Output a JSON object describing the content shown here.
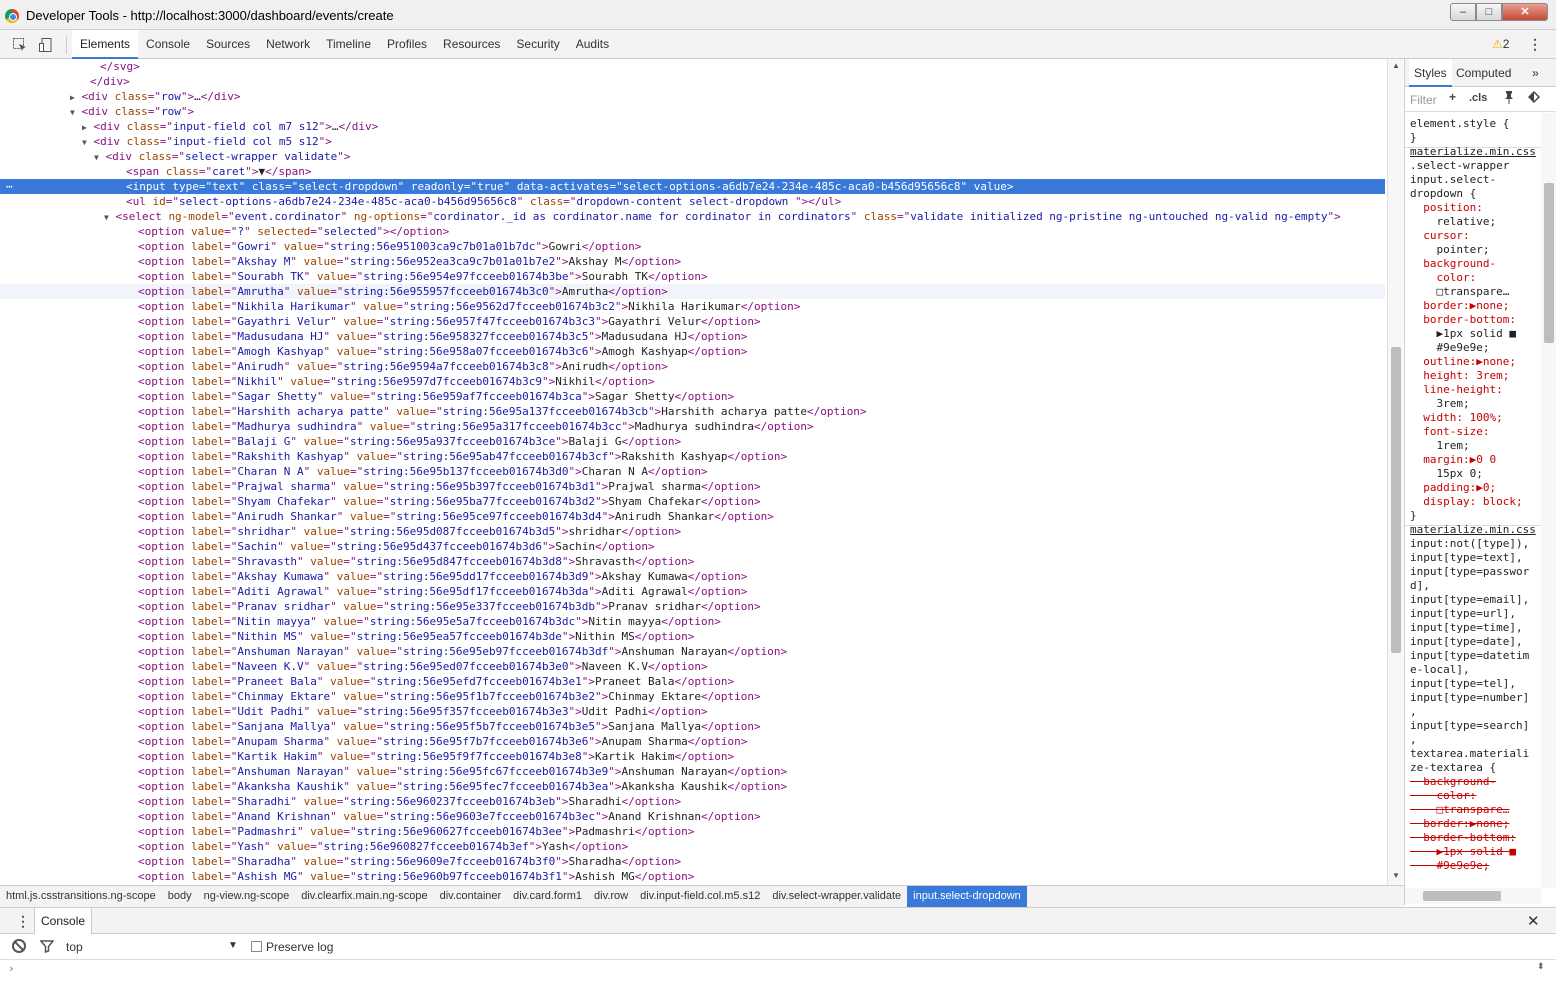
{
  "window": {
    "title": "Developer Tools - http://localhost:3000/dashboard/events/create",
    "min_label": "–",
    "max_label": "□",
    "close_label": "✕"
  },
  "toolbar": {
    "tabs": [
      "Elements",
      "Console",
      "Sources",
      "Network",
      "Timeline",
      "Profiles",
      "Resources",
      "Security",
      "Audits"
    ],
    "active_tab": "Elements",
    "warning_count": "2",
    "icons": [
      "inspect-icon",
      "device-mode-icon",
      "warning-icon",
      "kebab-menu-icon"
    ]
  },
  "tree": {
    "selected_index": 8,
    "hover_index": 15,
    "lines": [
      {
        "indent": 100,
        "parts": [
          [
            "t",
            "</svg>"
          ]
        ]
      },
      {
        "indent": 90,
        "parts": [
          [
            "t",
            "</div>"
          ]
        ]
      },
      {
        "indent": 80,
        "tri": "r",
        "parts": [
          [
            "t",
            "<div "
          ],
          [
            "a",
            "class"
          ],
          [
            "t",
            "=\""
          ],
          [
            "v",
            "row"
          ],
          [
            "t",
            "\">"
          ],
          [
            "x",
            "…"
          ],
          [
            "t",
            "</div>"
          ]
        ]
      },
      {
        "indent": 80,
        "tri": "d",
        "parts": [
          [
            "t",
            "<div "
          ],
          [
            "a",
            "class"
          ],
          [
            "t",
            "=\""
          ],
          [
            "v",
            "row"
          ],
          [
            "t",
            "\">"
          ]
        ]
      },
      {
        "indent": 92,
        "tri": "r",
        "parts": [
          [
            "t",
            "<div "
          ],
          [
            "a",
            "class"
          ],
          [
            "t",
            "=\""
          ],
          [
            "v",
            "input-field col m7 s12"
          ],
          [
            "t",
            "\">"
          ],
          [
            "x",
            "…"
          ],
          [
            "t",
            "</div>"
          ]
        ]
      },
      {
        "indent": 92,
        "tri": "d",
        "parts": [
          [
            "t",
            "<div "
          ],
          [
            "a",
            "class"
          ],
          [
            "t",
            "=\""
          ],
          [
            "v",
            "input-field col m5 s12"
          ],
          [
            "t",
            "\">"
          ]
        ]
      },
      {
        "indent": 104,
        "tri": "d",
        "parts": [
          [
            "t",
            "<div "
          ],
          [
            "a",
            "class"
          ],
          [
            "t",
            "=\""
          ],
          [
            "v",
            "select-wrapper validate"
          ],
          [
            "t",
            "\">"
          ]
        ]
      },
      {
        "indent": 126,
        "parts": [
          [
            "t",
            "<span "
          ],
          [
            "a",
            "class"
          ],
          [
            "t",
            "=\""
          ],
          [
            "v",
            "caret"
          ],
          [
            "t",
            "\">"
          ],
          [
            "x",
            "▼"
          ],
          [
            "t",
            "</span>"
          ]
        ]
      },
      {
        "indent": 126,
        "dots": true,
        "parts": [
          [
            "t",
            "<input "
          ],
          [
            "a",
            "type"
          ],
          [
            "t",
            "=\""
          ],
          [
            "v",
            "text"
          ],
          [
            "t",
            "\" "
          ],
          [
            "a",
            "class"
          ],
          [
            "t",
            "=\""
          ],
          [
            "v",
            "select-dropdown"
          ],
          [
            "t",
            "\" "
          ],
          [
            "a",
            "readonly"
          ],
          [
            "t",
            "=\""
          ],
          [
            "v",
            "true"
          ],
          [
            "t",
            "\" "
          ],
          [
            "a",
            "data-activates"
          ],
          [
            "t",
            "=\""
          ],
          [
            "v",
            "select-options-a6db7e24-234e-485c-aca0-b456d95656c8"
          ],
          [
            "t",
            "\" "
          ],
          [
            "a",
            "value"
          ],
          [
            "t",
            ">"
          ]
        ]
      },
      {
        "indent": 126,
        "parts": [
          [
            "t",
            "<ul "
          ],
          [
            "a",
            "id"
          ],
          [
            "t",
            "=\""
          ],
          [
            "v",
            "select-options-a6db7e24-234e-485c-aca0-b456d95656c8"
          ],
          [
            "t",
            "\" "
          ],
          [
            "a",
            "class"
          ],
          [
            "t",
            "=\""
          ],
          [
            "v",
            "dropdown-content select-dropdown "
          ],
          [
            "t",
            "\"></ul>"
          ]
        ]
      },
      {
        "indent": 114,
        "tri": "d",
        "parts": [
          [
            "t",
            "<select "
          ],
          [
            "a",
            "ng-model"
          ],
          [
            "t",
            "=\""
          ],
          [
            "v",
            "event.cordinator"
          ],
          [
            "t",
            "\" "
          ],
          [
            "a",
            "ng-options"
          ],
          [
            "t",
            "=\""
          ],
          [
            "v",
            "cordinator._id as cordinator.name for cordinator in cordinators"
          ],
          [
            "t",
            "\" "
          ],
          [
            "a",
            "class"
          ],
          [
            "t",
            "=\""
          ],
          [
            "v",
            "validate initialized ng-pristine ng-untouched ng-valid ng-empty"
          ],
          [
            "t",
            "\">"
          ]
        ]
      },
      {
        "indent": 138,
        "parts": [
          [
            "t",
            "<option "
          ],
          [
            "a",
            "value"
          ],
          [
            "t",
            "=\""
          ],
          [
            "v",
            "?"
          ],
          [
            "t",
            "\" "
          ],
          [
            "a",
            "selected"
          ],
          [
            "t",
            "=\""
          ],
          [
            "v",
            "selected"
          ],
          [
            "t",
            "\"></option>"
          ]
        ]
      },
      {
        "indent": 138,
        "opt": [
          "Gowri",
          "string:56e951003ca9c7b01a01b7dc"
        ]
      },
      {
        "indent": 138,
        "opt": [
          "Akshay M",
          "string:56e952ea3ca9c7b01a01b7e2"
        ]
      },
      {
        "indent": 138,
        "opt": [
          "Sourabh TK",
          "string:56e954e97fcceeb01674b3be"
        ]
      },
      {
        "indent": 138,
        "opt": [
          "Amrutha",
          "string:56e955957fcceeb01674b3c0"
        ]
      },
      {
        "indent": 138,
        "opt": [
          "Nikhila Harikumar",
          "string:56e9562d7fcceeb01674b3c2"
        ]
      },
      {
        "indent": 138,
        "opt": [
          "Gayathri Velur",
          "string:56e957f47fcceeb01674b3c3"
        ]
      },
      {
        "indent": 138,
        "opt": [
          "Madusudana HJ",
          "string:56e958327fcceeb01674b3c5"
        ]
      },
      {
        "indent": 138,
        "opt": [
          "Amogh Kashyap",
          "string:56e958a07fcceeb01674b3c6"
        ]
      },
      {
        "indent": 138,
        "opt": [
          "Anirudh",
          "string:56e9594a7fcceeb01674b3c8"
        ]
      },
      {
        "indent": 138,
        "opt": [
          "Nikhil",
          "string:56e9597d7fcceeb01674b3c9"
        ]
      },
      {
        "indent": 138,
        "opt": [
          "Sagar Shetty",
          "string:56e959af7fcceeb01674b3ca"
        ]
      },
      {
        "indent": 138,
        "opt": [
          "Harshith acharya patte",
          "string:56e95a137fcceeb01674b3cb"
        ]
      },
      {
        "indent": 138,
        "opt": [
          "Madhurya sudhindra",
          "string:56e95a317fcceeb01674b3cc"
        ]
      },
      {
        "indent": 138,
        "opt": [
          "Balaji G",
          "string:56e95a937fcceeb01674b3ce"
        ]
      },
      {
        "indent": 138,
        "opt": [
          "Rakshith Kashyap",
          "string:56e95ab47fcceeb01674b3cf"
        ]
      },
      {
        "indent": 138,
        "opt": [
          "Charan N A",
          "string:56e95b137fcceeb01674b3d0"
        ]
      },
      {
        "indent": 138,
        "opt": [
          "Prajwal sharma",
          "string:56e95b397fcceeb01674b3d1"
        ]
      },
      {
        "indent": 138,
        "opt": [
          "Shyam Chafekar",
          "string:56e95ba77fcceeb01674b3d2"
        ]
      },
      {
        "indent": 138,
        "opt": [
          "Anirudh Shankar",
          "string:56e95ce97fcceeb01674b3d4"
        ]
      },
      {
        "indent": 138,
        "opt": [
          "shridhar",
          "string:56e95d087fcceeb01674b3d5"
        ]
      },
      {
        "indent": 138,
        "opt": [
          "Sachin",
          "string:56e95d437fcceeb01674b3d6"
        ]
      },
      {
        "indent": 138,
        "opt": [
          "Shravasth",
          "string:56e95d847fcceeb01674b3d8"
        ]
      },
      {
        "indent": 138,
        "opt": [
          "Akshay Kumawa",
          "string:56e95dd17fcceeb01674b3d9"
        ]
      },
      {
        "indent": 138,
        "opt": [
          "Aditi Agrawal",
          "string:56e95df17fcceeb01674b3da"
        ]
      },
      {
        "indent": 138,
        "opt": [
          "Pranav sridhar",
          "string:56e95e337fcceeb01674b3db"
        ]
      },
      {
        "indent": 138,
        "opt": [
          "Nitin mayya",
          "string:56e95e5a7fcceeb01674b3dc"
        ]
      },
      {
        "indent": 138,
        "opt": [
          "Nithin MS",
          "string:56e95ea57fcceeb01674b3de"
        ]
      },
      {
        "indent": 138,
        "opt": [
          "Anshuman Narayan",
          "string:56e95eb97fcceeb01674b3df"
        ]
      },
      {
        "indent": 138,
        "opt": [
          "Naveen K.V",
          "string:56e95ed07fcceeb01674b3e0"
        ]
      },
      {
        "indent": 138,
        "opt": [
          "Praneet Bala",
          "string:56e95efd7fcceeb01674b3e1"
        ]
      },
      {
        "indent": 138,
        "opt": [
          "Chinmay Ektare",
          "string:56e95f1b7fcceeb01674b3e2"
        ]
      },
      {
        "indent": 138,
        "opt": [
          "Udit Padhi",
          "string:56e95f357fcceeb01674b3e3"
        ]
      },
      {
        "indent": 138,
        "opt": [
          "Sanjana Mallya",
          "string:56e95f5b7fcceeb01674b3e5"
        ]
      },
      {
        "indent": 138,
        "opt": [
          "Anupam Sharma",
          "string:56e95f7b7fcceeb01674b3e6"
        ]
      },
      {
        "indent": 138,
        "opt": [
          "Kartik Hakim",
          "string:56e95f9f7fcceeb01674b3e8"
        ]
      },
      {
        "indent": 138,
        "opt": [
          "Anshuman Narayan",
          "string:56e95fc67fcceeb01674b3e9"
        ]
      },
      {
        "indent": 138,
        "opt": [
          "Akanksha Kaushik",
          "string:56e95fec7fcceeb01674b3ea"
        ]
      },
      {
        "indent": 138,
        "opt": [
          "Sharadhi",
          "string:56e960237fcceeb01674b3eb"
        ]
      },
      {
        "indent": 138,
        "opt": [
          "Anand Krishnan",
          "string:56e9603e7fcceeb01674b3ec"
        ]
      },
      {
        "indent": 138,
        "opt": [
          "Padmashri",
          "string:56e960627fcceeb01674b3ee"
        ]
      },
      {
        "indent": 138,
        "opt": [
          "Yash",
          "string:56e960827fcceeb01674b3ef"
        ]
      },
      {
        "indent": 138,
        "opt": [
          "Sharadha",
          "string:56e9609e7fcceeb01674b3f0"
        ]
      },
      {
        "indent": 138,
        "opt": [
          "Ashish MG",
          "string:56e960b97fcceeb01674b3f1"
        ]
      }
    ]
  },
  "sidebar": {
    "tabs": [
      "Styles",
      "Computed",
      "»"
    ],
    "filter_placeholder": "Filter",
    "filter_tools": [
      "+",
      ".cls"
    ],
    "style_lines": [
      {
        "c": "x",
        "t": "element.style {"
      },
      {
        "c": "x",
        "t": "}"
      },
      {
        "c": "link",
        "t": "materialize.min.css"
      },
      {
        "c": "x",
        "t": ".select-wrapper"
      },
      {
        "c": "x",
        "t": "input.select-"
      },
      {
        "c": "x",
        "t": "dropdown {"
      },
      {
        "c": "prop",
        "t": "  position:"
      },
      {
        "c": "x",
        "t": "    relative;"
      },
      {
        "c": "prop",
        "t": "  cursor:"
      },
      {
        "c": "x",
        "t": "    pointer;"
      },
      {
        "c": "prop",
        "t": "  background-"
      },
      {
        "c": "prop",
        "t": "    color:"
      },
      {
        "c": "x",
        "t": "    □transpare…"
      },
      {
        "c": "prop",
        "t": "  border:▶none;"
      },
      {
        "c": "prop",
        "t": "  border-bottom:"
      },
      {
        "c": "x",
        "t": "    ▶1px solid ■"
      },
      {
        "c": "x",
        "t": "    #9e9e9e;"
      },
      {
        "c": "prop",
        "t": "  outline:▶none;"
      },
      {
        "c": "prop",
        "t": "  height: 3rem;"
      },
      {
        "c": "prop",
        "t": "  line-height:"
      },
      {
        "c": "x",
        "t": "    3rem;"
      },
      {
        "c": "prop",
        "t": "  width: 100%;"
      },
      {
        "c": "prop",
        "t": "  font-size:"
      },
      {
        "c": "x",
        "t": "    1rem;"
      },
      {
        "c": "prop",
        "t": "  margin:▶0 0"
      },
      {
        "c": "x",
        "t": "    15px 0;"
      },
      {
        "c": "prop",
        "t": "  padding:▶0;"
      },
      {
        "c": "prop",
        "t": "  display: block;"
      },
      {
        "c": "x",
        "t": "}"
      },
      {
        "c": "link",
        "t": "materialize.min.css"
      },
      {
        "c": "x",
        "t": "input:not([type]),"
      },
      {
        "c": "x",
        "t": "input[type=text],"
      },
      {
        "c": "x",
        "t": "input[type=passwor"
      },
      {
        "c": "x",
        "t": "d],"
      },
      {
        "c": "x",
        "t": "input[type=email],"
      },
      {
        "c": "x",
        "t": "input[type=url],"
      },
      {
        "c": "x",
        "t": "input[type=time],"
      },
      {
        "c": "x",
        "t": "input[type=date],"
      },
      {
        "c": "x",
        "t": "input[type=datetim"
      },
      {
        "c": "x",
        "t": "e-local],"
      },
      {
        "c": "x",
        "t": "input[type=tel],"
      },
      {
        "c": "x",
        "t": "input[type=number]"
      },
      {
        "c": "x",
        "t": ","
      },
      {
        "c": "x",
        "t": "input[type=search]"
      },
      {
        "c": "x",
        "t": ","
      },
      {
        "c": "x",
        "t": "textarea.materiali"
      },
      {
        "c": "x",
        "t": "ze-textarea {"
      },
      {
        "c": "strike",
        "t": "  background-"
      },
      {
        "c": "strike",
        "t": "    color:"
      },
      {
        "c": "strike",
        "t": "    □transpare…"
      },
      {
        "c": "strike",
        "t": "  border:▶none;"
      },
      {
        "c": "strike",
        "t": "  border-bottom:"
      },
      {
        "c": "strike",
        "t": "    ▶1px solid ■"
      },
      {
        "c": "strike",
        "t": "    #9e9e9e;"
      }
    ]
  },
  "breadcrumbs": {
    "items": [
      "html.js.csstransitions.ng-scope",
      "body",
      "ng-view.ng-scope",
      "div.clearfix.main.ng-scope",
      "div.container",
      "div.card.form1",
      "div.row",
      "div.input-field.col.m5.s12",
      "div.select-wrapper.validate",
      "input.select-dropdown"
    ],
    "active": "input.select-dropdown"
  },
  "console": {
    "tab_label": "Console",
    "context": "top",
    "preserve_log_label": "Preserve log",
    "preserve_log_checked": false,
    "prompt": "›"
  },
  "colors": {
    "selection": "#3879d9",
    "tag": "#881280",
    "attr_name": "#994500",
    "attr_value": "#1a1aa6"
  }
}
